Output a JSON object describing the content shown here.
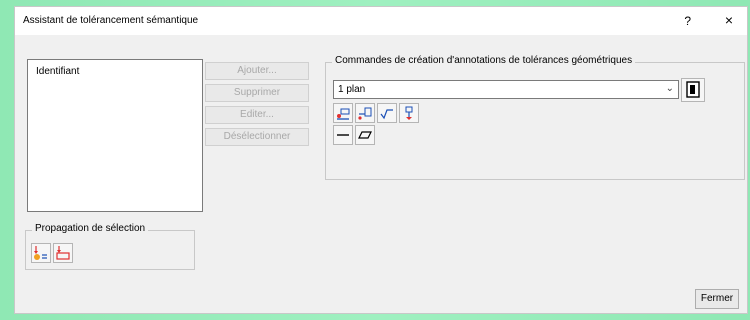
{
  "dialog": {
    "title": "Assistant de tolérancement sémantique",
    "help": "?",
    "close": "×"
  },
  "list": {
    "header": "Identifiant"
  },
  "side_buttons": {
    "add": "Ajouter...",
    "delete": "Supprimer",
    "edit": "Editer...",
    "deselect": "Désélectionner"
  },
  "commands": {
    "legend": "Commandes de création d'annotations de tolérances géométriques",
    "combo_value": "1 plan",
    "combo_arrow": "⌄"
  },
  "propagation": {
    "legend": "Propagation de sélection"
  },
  "footer": {
    "close_label": "Fermer"
  },
  "icons": {
    "accent_red": "#e03030",
    "accent_blue": "#1a4fb5",
    "accent_orange": "#f0a020"
  }
}
